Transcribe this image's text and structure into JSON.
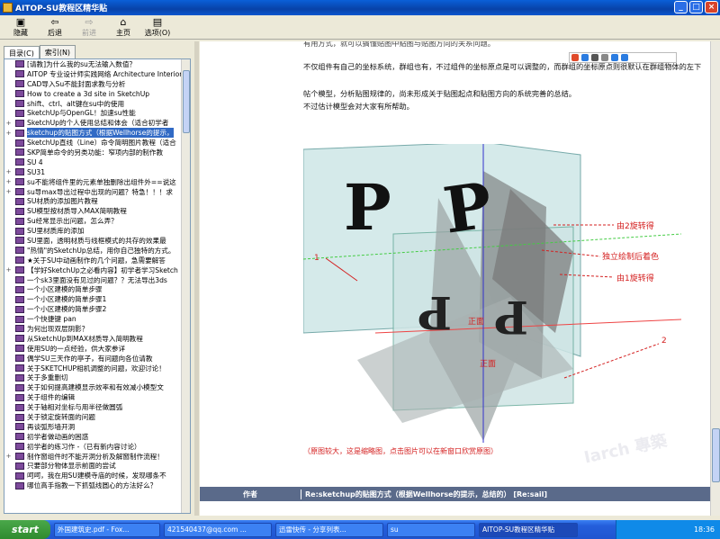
{
  "window": {
    "title": "AITOP-SU教程区精华贴"
  },
  "toolbar": {
    "items": [
      {
        "label": "隐藏",
        "icon": "hide-icon"
      },
      {
        "label": "后退",
        "icon": "back-icon"
      },
      {
        "label": "前进",
        "icon": "forward-icon"
      },
      {
        "label": "主页",
        "icon": "home-icon"
      },
      {
        "label": "选项(O)",
        "icon": "options-icon"
      }
    ]
  },
  "tabs": [
    {
      "label": "目录(C)"
    },
    {
      "label": "索引(N)"
    }
  ],
  "tree": {
    "items": [
      {
        "label": "[请教]为什么我的su无法输入数值？"
      },
      {
        "label": "AITOP 专业设计师实践网络 Architecture Interior"
      },
      {
        "label": "CAD导入Su不能封面求教与分析"
      },
      {
        "label": "How to create a 3d site in SketchUp"
      },
      {
        "label": "shift、ctrl、alt键在su中的使用"
      },
      {
        "label": "SketchUp与OpenGL！加速su性能"
      },
      {
        "label": "SketchUp的个人使用总结和体会（适合初学者"
      },
      {
        "label": "sketchup的贴图方式（根据Wellhorse的提示，"
      },
      {
        "label": "SketchUp直线（Line）命令简明图片教程（适合"
      },
      {
        "label": "SKP简单命令的另类功能：窄项内部的制作教"
      },
      {
        "label": "SU 4"
      },
      {
        "label": "SU31"
      },
      {
        "label": "su不能将组件里的元素单独删除出组件外==说这"
      },
      {
        "label": "su导max导出过程中出现的问题？特急！！！求"
      },
      {
        "label": "SU材质的添加图片教程"
      },
      {
        "label": "SU模型按材质导入MAX简明教程"
      },
      {
        "label": "Su经常显示出问题，怎么弄？"
      },
      {
        "label": "SU里材质库的添加"
      },
      {
        "label": "SU里面，透明材质与线框模式的共存的效果最"
      },
      {
        "label": "\"热情\"的SketchUp总结，用你自己独特的方式。"
      },
      {
        "label": "★关于SU中动画制作的几个问题，急需要解答"
      },
      {
        "label": "【学好SketchUp之必看内容】初学者学习Sketch"
      },
      {
        "label": "一个sk3里面没有见过的问题？？无法导出3ds"
      },
      {
        "label": "一个小区建模的简单步骤"
      },
      {
        "label": "一个小区建模的简单步骤1"
      },
      {
        "label": "一个小区建模的简单步骤2"
      },
      {
        "label": "一个快捷键 pan"
      },
      {
        "label": "为何出现双层阴影？"
      },
      {
        "label": "从SketchUp到MAX材质导入简明教程"
      },
      {
        "label": "使用SU的一点经验，供大家参详"
      },
      {
        "label": "偶学SU三天作的亭子，有问题向各位请教"
      },
      {
        "label": "关于SKETCHUP相机调整的问题，欢迎讨论！"
      },
      {
        "label": "关于多重删切"
      },
      {
        "label": "关于如何提高建模显示效率和有效减小模型文"
      },
      {
        "label": "关于组件的编辑"
      },
      {
        "label": "关于轴相对坐标与用半径做圆弧"
      },
      {
        "label": "关于锁定旋转面的问题"
      },
      {
        "label": "再谈弧形墙开洞"
      },
      {
        "label": "初学者做动画的困惑"
      },
      {
        "label": "初学者的练习作 -（已有新内容讨论）"
      },
      {
        "label": "制作窗组件时不能开洞分析及解窗制作流程！"
      },
      {
        "label": "只要部分物体显示前面的尝试"
      },
      {
        "label": "呵呵，我在用SU建模寺庙的时候，发现哪条不"
      },
      {
        "label": "哪位高手指教一下抓弧线圆心的方法好么？"
      }
    ]
  },
  "article": {
    "line0": "有用方式，就可以搞懂贴图中贴图与贴图方向的关系问题。",
    "line1": "不仅组件有自己的坐标系统，群组也有，不过组件的坐标原点是可以调整的，而群组的坐标原点则很默认在群组物体的左下",
    "line2": "帖个模型，分析贴图规律的，尚未形成关于贴图起点和贴图方向的系统完善的总结。",
    "line3": "不过估计模型会对大家有所帮助。",
    "caption": "（原图较大，这是缩略图，点击图片可以在新窗口欣赏原图）",
    "annotations": {
      "a1": "1",
      "a2": "2",
      "rot2": "由2旋转得",
      "indep": "独立绘制后着色",
      "rot1": "由1旋转得",
      "front1": "正面",
      "front2": "正面"
    }
  },
  "footer": {
    "author_label": "作者",
    "reply_title": "Re:sketchup的贴图方式（根据Wellhorse的提示，总结的）   [Re:sail]"
  },
  "taskbar": {
    "start": "start",
    "tasks": [
      {
        "label": "外国建筑史.pdf - Fox..."
      },
      {
        "label": "421540437@qq.com ..."
      },
      {
        "label": "迅雷快传 - 分享列表..."
      },
      {
        "label": "su"
      },
      {
        "label": "AITOP-SU教程区精华贴"
      }
    ],
    "time": "18:36"
  },
  "watermark": "Iarch 專築 www.iarch.cn",
  "colors": {
    "selection": "#316ac5",
    "annotation_red": "#d42020",
    "footer_bar": "#5a6a8a"
  }
}
